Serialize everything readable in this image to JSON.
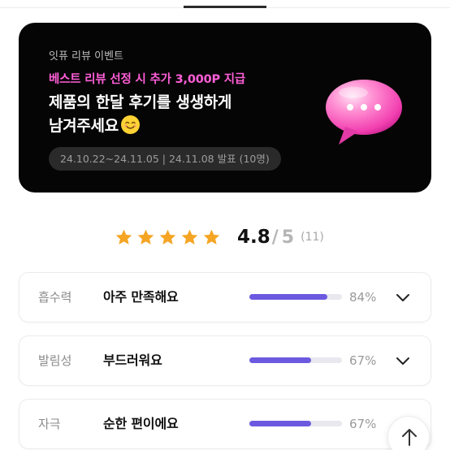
{
  "banner": {
    "event_label": "잇퓨 리뷰 이벤트",
    "promo": "베스트 리뷰 선정 시 추가 3,000P 지급",
    "headline_line1": "제품의 한달 후기를 생생하게",
    "headline_line2": "남겨주세요",
    "headline_emoji": "smiling-face-emoji",
    "period": "24.10.22~24.11.05 | 24.11.08 발표 (10명)",
    "bubble_icon": "pink-speech-bubble-icon",
    "background": "#050505",
    "promo_color": "#ff5fd8"
  },
  "rating": {
    "score": "4.8",
    "separator": "/",
    "max": "5",
    "count": "(11)",
    "stars_filled": 5,
    "star_color": "#f5a524"
  },
  "criteria": [
    {
      "name": "흡수력",
      "answer": "아주 만족해요",
      "percent_label": "84%",
      "value": 84
    },
    {
      "name": "발림성",
      "answer": "부드러워요",
      "percent_label": "67%",
      "value": 67
    },
    {
      "name": "자극",
      "answer": "순한 편이에요",
      "percent_label": "67%",
      "value": 67
    }
  ],
  "bar_color": "#6b5ae0",
  "icons": {
    "expand": "chevron-down-icon",
    "scroll_top": "arrow-up-icon"
  }
}
